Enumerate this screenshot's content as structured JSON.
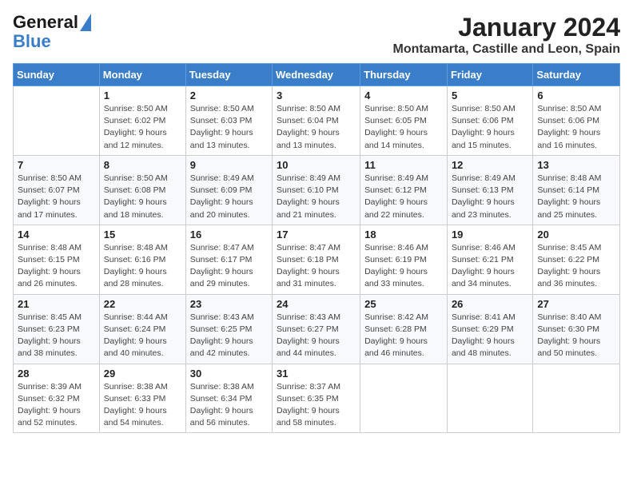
{
  "logo": {
    "line1": "General",
    "line2": "Blue"
  },
  "title": {
    "month_year": "January 2024",
    "location": "Montamarta, Castille and Leon, Spain"
  },
  "header": {
    "days": [
      "Sunday",
      "Monday",
      "Tuesday",
      "Wednesday",
      "Thursday",
      "Friday",
      "Saturday"
    ]
  },
  "weeks": [
    [
      {
        "day": "",
        "info": ""
      },
      {
        "day": "1",
        "info": "Sunrise: 8:50 AM\nSunset: 6:02 PM\nDaylight: 9 hours\nand 12 minutes."
      },
      {
        "day": "2",
        "info": "Sunrise: 8:50 AM\nSunset: 6:03 PM\nDaylight: 9 hours\nand 13 minutes."
      },
      {
        "day": "3",
        "info": "Sunrise: 8:50 AM\nSunset: 6:04 PM\nDaylight: 9 hours\nand 13 minutes."
      },
      {
        "day": "4",
        "info": "Sunrise: 8:50 AM\nSunset: 6:05 PM\nDaylight: 9 hours\nand 14 minutes."
      },
      {
        "day": "5",
        "info": "Sunrise: 8:50 AM\nSunset: 6:06 PM\nDaylight: 9 hours\nand 15 minutes."
      },
      {
        "day": "6",
        "info": "Sunrise: 8:50 AM\nSunset: 6:06 PM\nDaylight: 9 hours\nand 16 minutes."
      }
    ],
    [
      {
        "day": "7",
        "info": "Sunrise: 8:50 AM\nSunset: 6:07 PM\nDaylight: 9 hours\nand 17 minutes."
      },
      {
        "day": "8",
        "info": "Sunrise: 8:50 AM\nSunset: 6:08 PM\nDaylight: 9 hours\nand 18 minutes."
      },
      {
        "day": "9",
        "info": "Sunrise: 8:49 AM\nSunset: 6:09 PM\nDaylight: 9 hours\nand 20 minutes."
      },
      {
        "day": "10",
        "info": "Sunrise: 8:49 AM\nSunset: 6:10 PM\nDaylight: 9 hours\nand 21 minutes."
      },
      {
        "day": "11",
        "info": "Sunrise: 8:49 AM\nSunset: 6:12 PM\nDaylight: 9 hours\nand 22 minutes."
      },
      {
        "day": "12",
        "info": "Sunrise: 8:49 AM\nSunset: 6:13 PM\nDaylight: 9 hours\nand 23 minutes."
      },
      {
        "day": "13",
        "info": "Sunrise: 8:48 AM\nSunset: 6:14 PM\nDaylight: 9 hours\nand 25 minutes."
      }
    ],
    [
      {
        "day": "14",
        "info": "Sunrise: 8:48 AM\nSunset: 6:15 PM\nDaylight: 9 hours\nand 26 minutes."
      },
      {
        "day": "15",
        "info": "Sunrise: 8:48 AM\nSunset: 6:16 PM\nDaylight: 9 hours\nand 28 minutes."
      },
      {
        "day": "16",
        "info": "Sunrise: 8:47 AM\nSunset: 6:17 PM\nDaylight: 9 hours\nand 29 minutes."
      },
      {
        "day": "17",
        "info": "Sunrise: 8:47 AM\nSunset: 6:18 PM\nDaylight: 9 hours\nand 31 minutes."
      },
      {
        "day": "18",
        "info": "Sunrise: 8:46 AM\nSunset: 6:19 PM\nDaylight: 9 hours\nand 33 minutes."
      },
      {
        "day": "19",
        "info": "Sunrise: 8:46 AM\nSunset: 6:21 PM\nDaylight: 9 hours\nand 34 minutes."
      },
      {
        "day": "20",
        "info": "Sunrise: 8:45 AM\nSunset: 6:22 PM\nDaylight: 9 hours\nand 36 minutes."
      }
    ],
    [
      {
        "day": "21",
        "info": "Sunrise: 8:45 AM\nSunset: 6:23 PM\nDaylight: 9 hours\nand 38 minutes."
      },
      {
        "day": "22",
        "info": "Sunrise: 8:44 AM\nSunset: 6:24 PM\nDaylight: 9 hours\nand 40 minutes."
      },
      {
        "day": "23",
        "info": "Sunrise: 8:43 AM\nSunset: 6:25 PM\nDaylight: 9 hours\nand 42 minutes."
      },
      {
        "day": "24",
        "info": "Sunrise: 8:43 AM\nSunset: 6:27 PM\nDaylight: 9 hours\nand 44 minutes."
      },
      {
        "day": "25",
        "info": "Sunrise: 8:42 AM\nSunset: 6:28 PM\nDaylight: 9 hours\nand 46 minutes."
      },
      {
        "day": "26",
        "info": "Sunrise: 8:41 AM\nSunset: 6:29 PM\nDaylight: 9 hours\nand 48 minutes."
      },
      {
        "day": "27",
        "info": "Sunrise: 8:40 AM\nSunset: 6:30 PM\nDaylight: 9 hours\nand 50 minutes."
      }
    ],
    [
      {
        "day": "28",
        "info": "Sunrise: 8:39 AM\nSunset: 6:32 PM\nDaylight: 9 hours\nand 52 minutes."
      },
      {
        "day": "29",
        "info": "Sunrise: 8:38 AM\nSunset: 6:33 PM\nDaylight: 9 hours\nand 54 minutes."
      },
      {
        "day": "30",
        "info": "Sunrise: 8:38 AM\nSunset: 6:34 PM\nDaylight: 9 hours\nand 56 minutes."
      },
      {
        "day": "31",
        "info": "Sunrise: 8:37 AM\nSunset: 6:35 PM\nDaylight: 9 hours\nand 58 minutes."
      },
      {
        "day": "",
        "info": ""
      },
      {
        "day": "",
        "info": ""
      },
      {
        "day": "",
        "info": ""
      }
    ]
  ]
}
